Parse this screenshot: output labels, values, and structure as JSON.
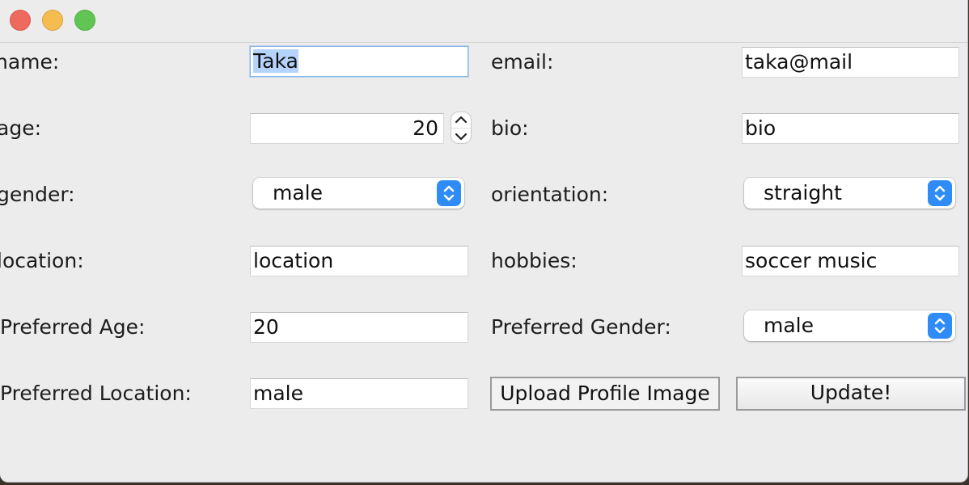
{
  "window": {
    "title": ""
  },
  "left": {
    "name": {
      "label": "name:",
      "value": "Taka"
    },
    "age": {
      "label": "age:",
      "value": "20"
    },
    "gender": {
      "label": "gender:",
      "value": "male"
    },
    "location": {
      "label": "location:",
      "value": "location"
    },
    "preferred_age": {
      "label": "Preferred Age:",
      "value": "20"
    },
    "preferred_location": {
      "label": "Preferred Location:",
      "value": "male"
    }
  },
  "right": {
    "email": {
      "label": "email:",
      "value": "taka@mail"
    },
    "bio": {
      "label": "bio:",
      "value": "bio"
    },
    "orientation": {
      "label": "orientation:",
      "value": "straight"
    },
    "hobbies": {
      "label": "hobbies:",
      "value": "soccer music"
    },
    "preferred_gender": {
      "label": "Preferred Gender:",
      "value": "male"
    }
  },
  "buttons": {
    "upload": "Upload Profile Image",
    "update": "Update!"
  },
  "colors": {
    "selection": "#b5d3fb",
    "focus_ring": "#8ab4e8",
    "combo_accent": "#2f8cf7"
  }
}
